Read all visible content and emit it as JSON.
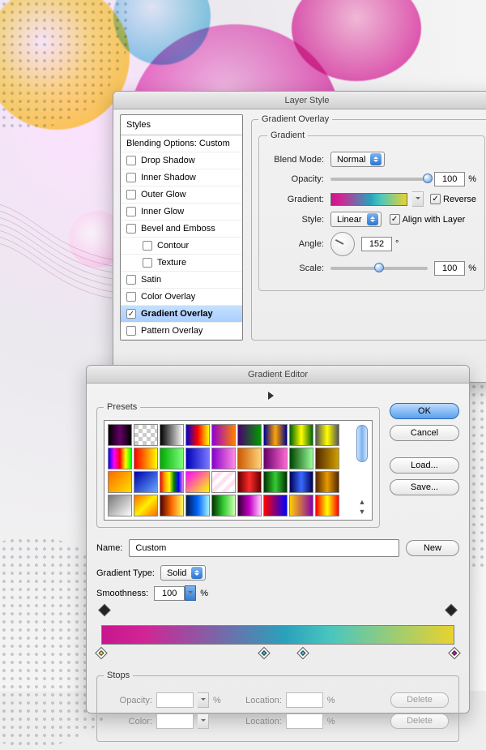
{
  "layerStyle": {
    "title": "Layer Style",
    "stylesHeader": "Styles",
    "blendingOptions": "Blending Options: Custom",
    "items": [
      {
        "label": "Drop Shadow",
        "checked": false
      },
      {
        "label": "Inner Shadow",
        "checked": false
      },
      {
        "label": "Outer Glow",
        "checked": false
      },
      {
        "label": "Inner Glow",
        "checked": false
      },
      {
        "label": "Bevel and Emboss",
        "checked": false
      },
      {
        "label": "Contour",
        "checked": false,
        "sub": true
      },
      {
        "label": "Texture",
        "checked": false,
        "sub": true
      },
      {
        "label": "Satin",
        "checked": false
      },
      {
        "label": "Color Overlay",
        "checked": false
      },
      {
        "label": "Gradient Overlay",
        "checked": true,
        "selected": true
      },
      {
        "label": "Pattern Overlay",
        "checked": false
      }
    ],
    "overlay": {
      "groupTitle": "Gradient Overlay",
      "gradientTitle": "Gradient",
      "blendModeLabel": "Blend Mode:",
      "blendMode": "Normal",
      "opacityLabel": "Opacity:",
      "opacity": "100",
      "pct": "%",
      "gradientLabel": "Gradient:",
      "reverse": "Reverse",
      "reverseChecked": true,
      "styleLabel": "Style:",
      "style": "Linear",
      "align": "Align with Layer",
      "alignChecked": true,
      "angleLabel": "Angle:",
      "angle": "152",
      "deg": "°",
      "scaleLabel": "Scale:",
      "scale": "100"
    }
  },
  "gradientEditor": {
    "title": "Gradient Editor",
    "presetsLabel": "Presets",
    "buttons": {
      "ok": "OK",
      "cancel": "Cancel",
      "load": "Load...",
      "save": "Save...",
      "new": "New"
    },
    "nameLabel": "Name:",
    "name": "Custom",
    "typeLabel": "Gradient Type:",
    "type": "Solid",
    "smoothLabel": "Smoothness:",
    "smoothness": "100",
    "pct": "%",
    "stopsLabel": "Stops",
    "opRowLabel": "Opacity:",
    "locLabel": "Location:",
    "colorLabel": "Color:",
    "delete": "Delete",
    "presetSwatches": [
      "linear-gradient(90deg,#000,#640066,#000)",
      "repeating-conic-gradient(#fff 0 25%,#ccc 0 50%) 0 0/10px 10px",
      "linear-gradient(90deg,#000,#fff)",
      "linear-gradient(90deg,#0000cc,#ff0000,#ffff00)",
      "linear-gradient(90deg,#9400d3,#ff7f00)",
      "linear-gradient(90deg,#4b006e,#009a00)",
      "linear-gradient(90deg,#00008b,#ffa500,#00008b)",
      "linear-gradient(90deg,#006400,#ffff00,#006400)",
      "linear-gradient(90deg,#555,#ffff00,#555)",
      "linear-gradient(90deg,#00f,#f0f,#f00,#ff0,#0f0)",
      "linear-gradient(90deg,#f00,#ff0)",
      "linear-gradient(90deg,#0a0,#7cff7c)",
      "linear-gradient(90deg,#00b,#77f)",
      "linear-gradient(90deg,#8800cc,#ff8ae0)",
      "linear-gradient(90deg,#cc5a00,#ffd37a)",
      "linear-gradient(90deg,#660066,#ff66d4)",
      "linear-gradient(90deg,#004400,#99ff99)",
      "linear-gradient(90deg,#502800,#d2a000)",
      "linear-gradient(135deg,#ff6a00,#ffe100)",
      "linear-gradient(135deg,#00a,#6af)",
      "linear-gradient(90deg,red,orange,yellow,green,blue,violet)",
      "linear-gradient(135deg,#f0f,#ff0)",
      "repeating-linear-gradient(135deg,#fff 0 5px,#ffe1f0 5px 10px)",
      "linear-gradient(90deg,#660000,#ff2a2a,#660000)",
      "linear-gradient(90deg,#003300,#33cc33,#003300)",
      "linear-gradient(90deg,#000055,#3a6aff,#000055)",
      "linear-gradient(90deg,#552800,#e89a00,#552800)",
      "linear-gradient(135deg,#777,#fff)",
      "linear-gradient(135deg,#ff6a00,#ffef00,#ff6a00)",
      "linear-gradient(90deg,#4e0000,#ff6a00,#fffa60)",
      "linear-gradient(90deg,#001a4e,#0066ff,#a0f0ff)",
      "linear-gradient(90deg,#003300,#33cc33,#d0ffb0)",
      "linear-gradient(90deg,#330033,#c800c8,#ffccff)",
      "linear-gradient(90deg,#ff0000,#0000ff)",
      "linear-gradient(90deg,#ffcc00,#8800aa)",
      "linear-gradient(90deg,#ff0000,#ffff00,#ff0000)"
    ],
    "colorStops": [
      {
        "pos": 0,
        "color": "#ecdc2c"
      },
      {
        "pos": 46,
        "color": "#2fb3c8"
      },
      {
        "pos": 57,
        "color": "#36c2e0"
      },
      {
        "pos": 100,
        "color": "#c8168f"
      }
    ]
  }
}
